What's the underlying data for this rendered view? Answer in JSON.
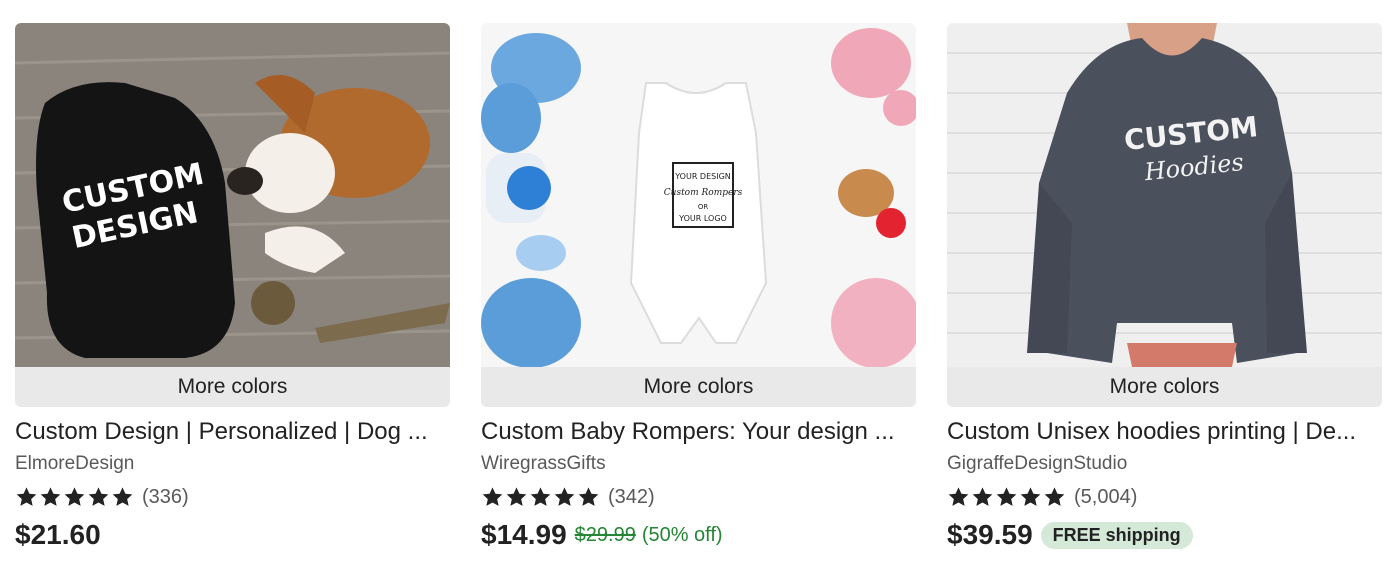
{
  "listings": [
    {
      "more_colors": "More colors",
      "image_text": [
        "CUSTOM",
        "DESIGN"
      ],
      "title": "Custom Design | Personalized | Dog ...",
      "shop": "ElmoreDesign",
      "stars": 5,
      "reviews": "(336)",
      "price": "$21.60"
    },
    {
      "more_colors": "More colors",
      "image_text": [
        "YOUR DESIGN",
        "Custom Rompers",
        "OR",
        "YOUR LOGO"
      ],
      "title": "Custom Baby Rompers: Your design ...",
      "shop": "WiregrassGifts",
      "stars": 5,
      "reviews": "(342)",
      "price": "$14.99",
      "original_price": "$29.99",
      "discount": "(50% off)"
    },
    {
      "more_colors": "More colors",
      "image_text": [
        "CUSTOM",
        "Hoodies"
      ],
      "title": "Custom Unisex hoodies printing | De...",
      "shop": "GigraffeDesignStudio",
      "stars": 5,
      "reviews": "(5,004)",
      "price": "$39.59",
      "badge": "FREE shipping"
    }
  ],
  "colors": {
    "text": "#222222",
    "muted": "#595959",
    "sale_green": "#258635",
    "badge_bg": "#d4e9d7",
    "overlay": "#e9e9e9"
  }
}
